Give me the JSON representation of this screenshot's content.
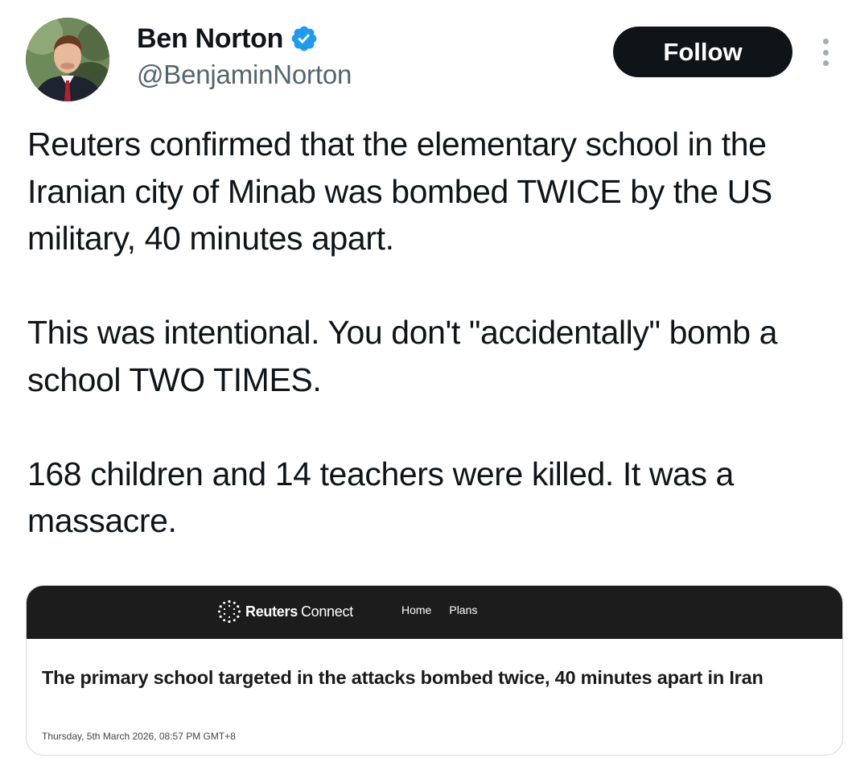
{
  "author": {
    "display_name": "Ben Norton",
    "handle": "@BenjaminNorton",
    "verified": true,
    "verified_color": "#1d9bf0"
  },
  "follow_button": {
    "label": "Follow"
  },
  "more_menu": {
    "icon": "more-vertical-icon"
  },
  "tweet": {
    "paragraphs": [
      "Reuters confirmed that the elementary school in the Iranian city of Minab was bombed TWICE by the US military, 40 minutes apart.",
      "This was intentional. You don't \"accidentally\" bomb a school TWO TIMES.",
      "168 children and 14 teachers were killed. It was a massacre."
    ]
  },
  "card": {
    "brand_bold": "Reuters",
    "brand_light": "Connect",
    "nav": [
      "Home",
      "Plans"
    ],
    "headline": "The primary school targeted in the attacks bombed twice, 40 minutes apart in Iran",
    "date": "Thursday, 5th March 2026, 08:57 PM GMT+8",
    "header_color": "#1c1c1c"
  }
}
